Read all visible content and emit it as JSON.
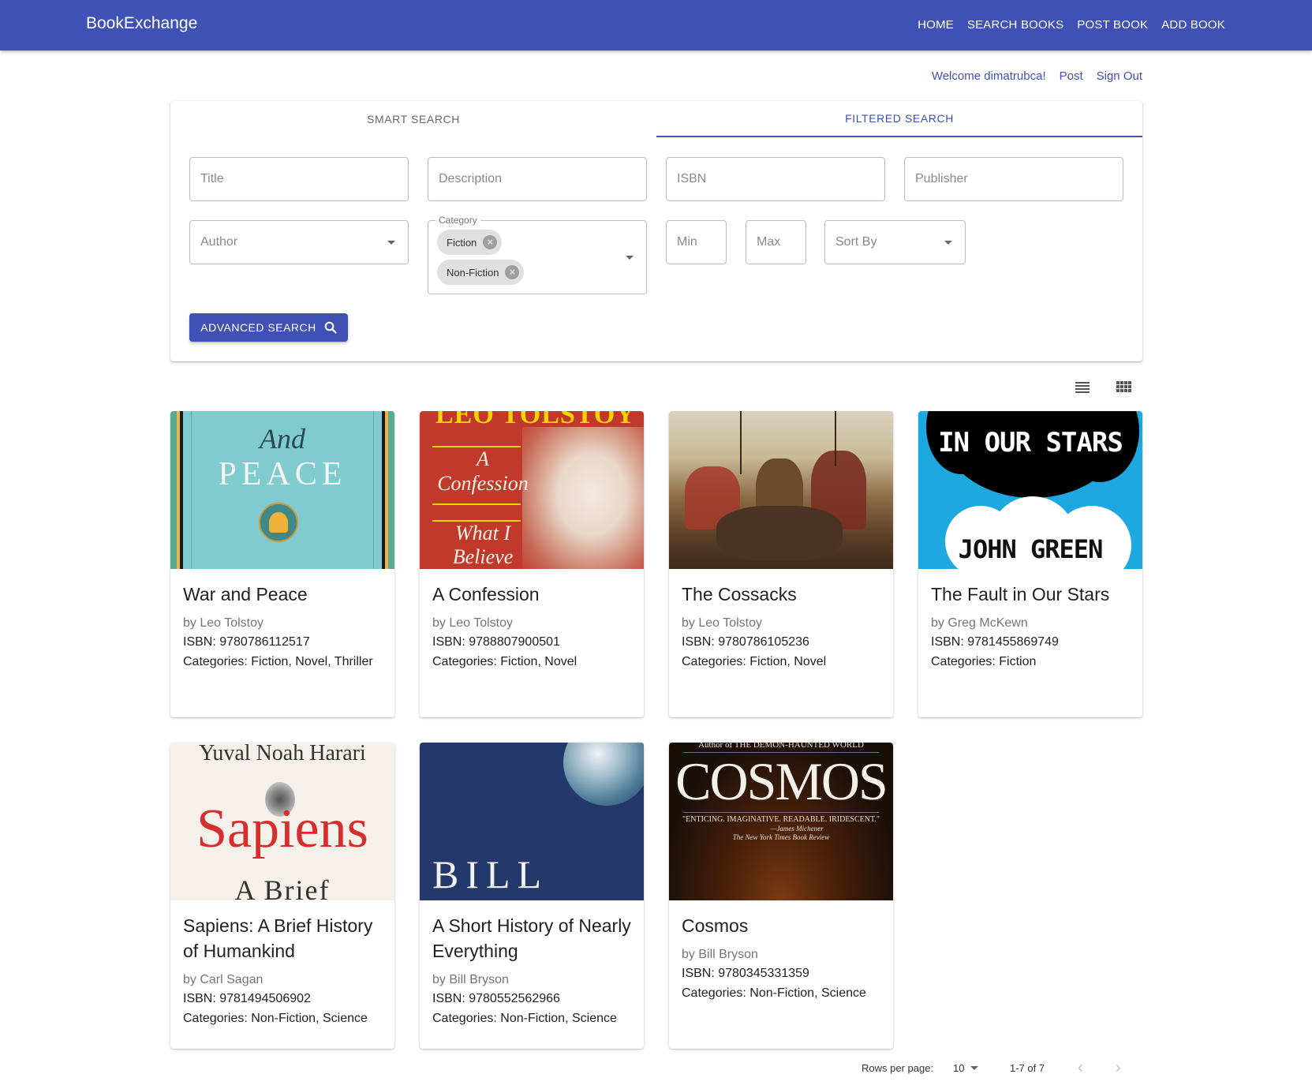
{
  "app": {
    "brand": "BookExchange"
  },
  "nav": {
    "home": "HOME",
    "search": "SEARCH BOOKS",
    "post": "POST BOOK",
    "add": "ADD BOOK"
  },
  "user": {
    "welcome": "Welcome dimatrubca!",
    "post": "Post",
    "signout": "Sign Out"
  },
  "tabs": {
    "smart": "SMART SEARCH",
    "filtered": "FILTERED SEARCH"
  },
  "filters": {
    "title": "Title",
    "description": "Description",
    "isbn": "ISBN",
    "publisher": "Publisher",
    "author": "Author",
    "category_label": "Category",
    "category_chips": [
      "Fiction",
      "Non-Fiction"
    ],
    "min": "Min",
    "max": "Max",
    "sort": "Sort By",
    "advanced_button": "ADVANCED SEARCH"
  },
  "books": [
    {
      "title": "War and Peace",
      "author": "by Leo Tolstoy",
      "isbn": "ISBN: 9780786112517",
      "categories": "Categories: Fiction, Novel, Thriller",
      "cover_text": [
        "And",
        "PEACE"
      ],
      "cover_color": "#7cc5c8"
    },
    {
      "title": "A Confession",
      "author": "by Leo Tolstoy",
      "isbn": "ISBN: 9788807900501",
      "categories": "Categories: Fiction, Novel",
      "cover_text": [
        "LEO TOLSTOY",
        "A",
        "Confession",
        "What I",
        "Believe"
      ],
      "cover_color": "#c0392b"
    },
    {
      "title": "The Cossacks",
      "author": "by Leo Tolstoy",
      "isbn": "ISBN: 9780786105236",
      "categories": "Categories: Fiction, Novel",
      "cover_text": [],
      "cover_color": "#8a6a45"
    },
    {
      "title": "The Fault in Our Stars",
      "author": "by Greg McKewn",
      "isbn": "ISBN: 9781455869749",
      "categories": "Categories: Fiction",
      "cover_text": [
        "IN OUR STARS",
        "JOHN GREEN"
      ],
      "cover_color": "#1ea8e0"
    },
    {
      "title": "Sapiens: A Brief History of Humankind",
      "author": "by Carl Sagan",
      "isbn": "ISBN: 9781494506902",
      "categories": "Categories: Non-Fiction, Science",
      "cover_text": [
        "Yuval Noah Harari",
        "Sapiens",
        "A Brief"
      ],
      "cover_color": "#f5f1ea"
    },
    {
      "title": "A Short History of Nearly Everything",
      "author": "by Bill Bryson",
      "isbn": "ISBN: 9780552562966",
      "categories": "Categories: Non-Fiction, Science",
      "cover_text": [
        "BILL"
      ],
      "cover_color": "#24396b"
    },
    {
      "title": "Cosmos",
      "author": "by Bill Bryson",
      "isbn": "ISBN: 9780345331359",
      "categories": "Categories: Non-Fiction, Science",
      "cover_text": [
        "Author of THE DEMON-HAUNTED WORLD",
        "COSMOS",
        "\"ENTICING. IMAGINATIVE. READABLE. IRIDESCENT.\"",
        "—James Michener",
        "The New York Times Book Review"
      ],
      "cover_color": "#1a0f08"
    }
  ],
  "pagination": {
    "rows_label": "Rows per page:",
    "rows_value": "10",
    "range": "1-7 of 7"
  },
  "colors": {
    "primary": "#3f51b5"
  }
}
